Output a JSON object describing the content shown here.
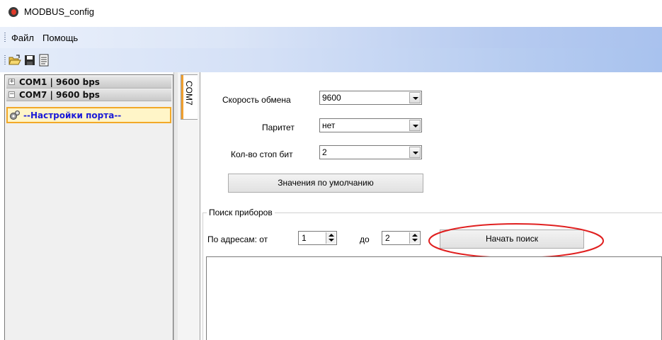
{
  "window": {
    "title": "MODBUS_config"
  },
  "menu": {
    "items": [
      "Файл",
      "Помощь"
    ]
  },
  "toolbar": {
    "icons": [
      "open-folder-icon",
      "save-icon",
      "document-icon"
    ]
  },
  "tree": {
    "items": [
      {
        "label": "COM1 | 9600 bps",
        "expander": "+"
      },
      {
        "label": "COM7 | 9600 bps",
        "expander": "−"
      },
      {
        "label": "--Настройки порта--",
        "selected": true
      }
    ]
  },
  "tab": {
    "label": "COM7"
  },
  "settings": {
    "baud_label": "Скорость обмена",
    "baud_value": "9600",
    "parity_label": "Паритет",
    "parity_value": "нет",
    "stopbits_label": "Кол-во стоп бит",
    "stopbits_value": "2",
    "defaults_button": "Значения по умолчанию"
  },
  "search": {
    "group_title": "Поиск приборов",
    "from_label": "По адресам: от",
    "from_value": "1",
    "to_label": "до",
    "to_value": "2",
    "start_button": "Начать поиск"
  },
  "colors": {
    "annotation": "#e02020",
    "selection_border": "#f2a928",
    "selected_text": "#1a1ad8"
  }
}
